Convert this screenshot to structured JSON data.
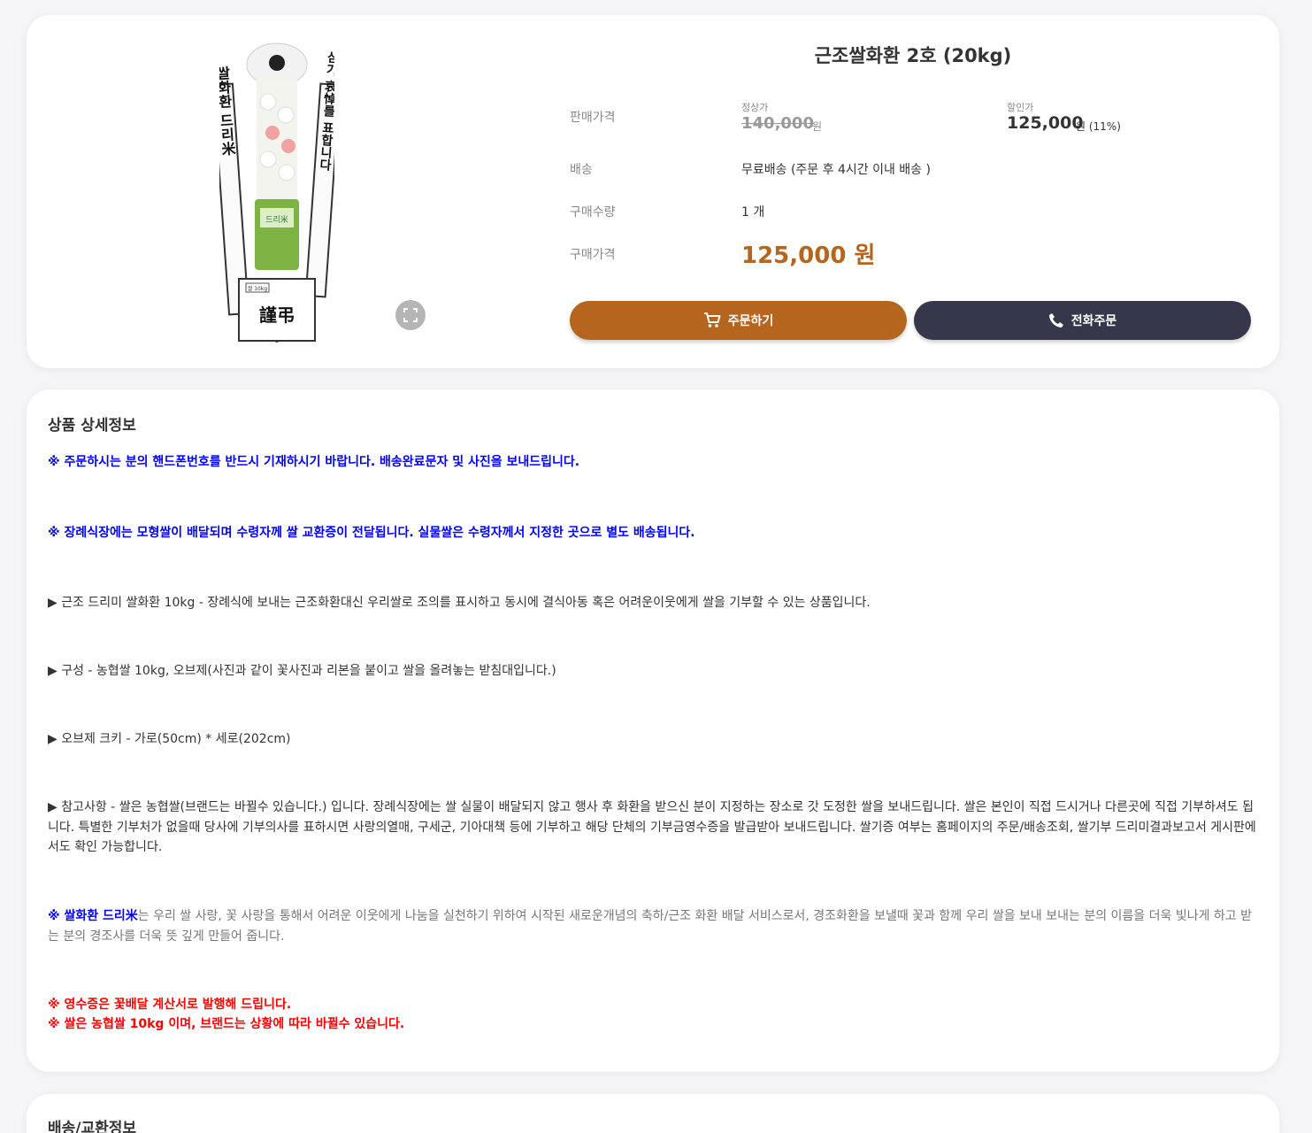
{
  "product": {
    "title": "근조쌀화환 2호 (20kg)",
    "labels": {
      "sale_price": "판매가격",
      "shipping": "배송",
      "quantity": "구매수량",
      "total": "구매가격"
    },
    "original_caption": "정상가",
    "original_price": "140,000",
    "currency": "원",
    "discount_caption": "할인가",
    "discount_price": "125,000",
    "discount_rate": "원 (11%)",
    "shipping_value": "무료배송 (주문 후 4시간 이내 배송 )",
    "quantity_value": "1 개",
    "total_price": "125,000 원",
    "order_button": "주문하기",
    "phone_button": "전화주문",
    "image": {
      "ribbon_left": "쌀화환 드리米",
      "ribbon_right": "삼가 哀悼를 표합니다",
      "rice_bag": "드리米",
      "sign_tag": "쌀 10kg",
      "sign_text": "謹弔"
    }
  },
  "detail": {
    "title": "상품 상세정보",
    "notice1": "※ 주문하시는 분의 핸드폰번호를 반드시 기재하시기 바랍니다. 배송완료문자 및 사진을 보내드립니다.",
    "notice2": "※ 장례식장에는 모형쌀이 배달되며 수령자께 쌀 교환증이 전달됩니다. 실물쌀은 수령자께서 지정한 곳으로 별도 배송됩니다.",
    "item1": "▶ 근조 드리미 쌀화환 10kg - 장례식에 보내는 근조화환대신 우리쌀로 조의를 표시하고 동시에 결식아동 혹은 어려운이웃에게 쌀을 기부할 수 있는 상품입니다.",
    "item2": "▶ 구성 - 농협쌀 10kg,  오브제(사진과 같이 꽃사진과 리본을 붙이고 쌀을 올려놓는 받침대입니다.)",
    "item3": "▶ 오브제 크키 - 가로(50cm) * 세로(202cm)",
    "item4": "▶ 참고사항 - 쌀은 농협쌀(브랜드는 바뀔수 있습니다.) 입니다.  장례식장에는 쌀 실물이 배달되지 않고 행사 후  화환을 받으신 분이 지정하는 장소로 갓 도정한 쌀을 보내드립니다.  쌀은 본인이 직접 드시거나  다른곳에 직접 기부하셔도 됩니다.  특별한 기부처가 없을때 당사에 기부의사를 표하시면  사랑의열매, 구세군, 기아대책 등에 기부하고 해당 단체의 기부금영수증을  발급받아 보내드립니다. 쌀기증 여부는 홈페이지의 주문/배송조회, 쌀기부 드리미결과보고서 게시판에서도 확인 가능합니다.",
    "brand_prefix": "※ 쌀화환 드리米",
    "brand_text": "는 우리 쌀 사랑, 꽃 사랑을 통해서 어려운 이웃에게 나눔을 실천하기 위하여 시작된 새로운개념의 축하/근조 화환 배달 서비스로서, 경조화환을 보낼때 꽃과 함께 우리 쌀을 보내 보내는 분의 이름을 더욱 빛나게 하고 받는 분의 경조사를 더욱 뜻 깊게 만들어 줍니다.",
    "receipt1": "※ 영수증은 꽃배달 계산서로 발행해 드립니다.",
    "receipt2": "※ 쌀은 농협쌀 10kg 이며, 브랜드는 상황에 따라 바뀔수 있습니다."
  },
  "shipping_section": {
    "title": "배송/교환정보"
  },
  "colors": {
    "accent": "#b5651d",
    "dark_button": "#36374a",
    "notice_blue": "#0000ff",
    "notice_red": "#ff0000"
  }
}
